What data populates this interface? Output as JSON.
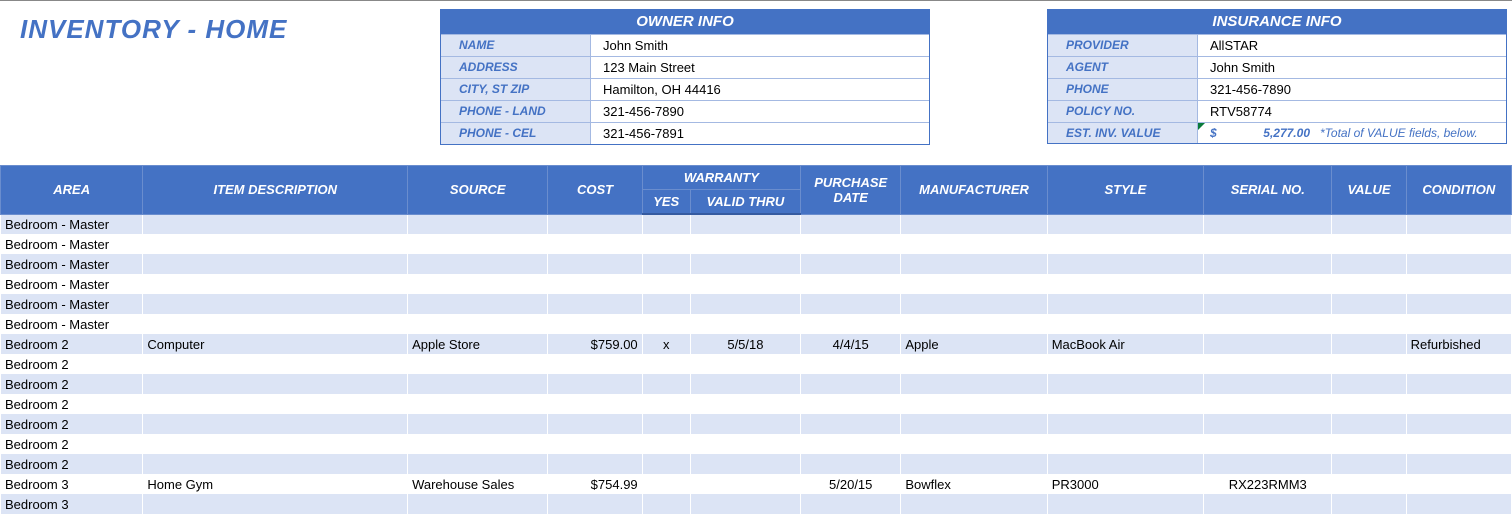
{
  "title": "INVENTORY - HOME",
  "owner_info": {
    "header": "OWNER INFO",
    "labels": {
      "name": "NAME",
      "address": "ADDRESS",
      "city": "CITY, ST  ZIP",
      "phone_land": "PHONE - LAND",
      "phone_cel": "PHONE - CEL"
    },
    "values": {
      "name": "John Smith",
      "address": "123 Main Street",
      "city": "Hamilton, OH  44416",
      "phone_land": "321-456-7890",
      "phone_cel": "321-456-7891"
    }
  },
  "insurance_info": {
    "header": "INSURANCE INFO",
    "labels": {
      "provider": "PROVIDER",
      "agent": "AGENT",
      "phone": "PHONE",
      "policy": "POLICY NO.",
      "est": "EST. INV. VALUE"
    },
    "values": {
      "provider": "AllSTAR",
      "agent": "John Smith",
      "phone": "321-456-7890",
      "policy": "RTV58774"
    },
    "est_currency": "$",
    "est_amount": "5,277.00",
    "est_note": "*Total of VALUE fields, below."
  },
  "columns": {
    "area": "AREA",
    "desc": "ITEM DESCRIPTION",
    "source": "SOURCE",
    "cost": "COST",
    "warranty": "WARRANTY",
    "yes": "YES",
    "valid_thru": "VALID THRU",
    "pdate": "PURCHASE DATE",
    "mfr": "MANUFACTURER",
    "style": "STYLE",
    "serial": "SERIAL NO.",
    "value": "VALUE",
    "cond": "CONDITION"
  },
  "rows": [
    {
      "area": "Bedroom - Master",
      "desc": "",
      "source": "",
      "cost": "",
      "yes": "",
      "thru": "",
      "pdate": "",
      "mfr": "",
      "style": "",
      "serial": "",
      "value": "",
      "cond": ""
    },
    {
      "area": "Bedroom - Master",
      "desc": "",
      "source": "",
      "cost": "",
      "yes": "",
      "thru": "",
      "pdate": "",
      "mfr": "",
      "style": "",
      "serial": "",
      "value": "",
      "cond": ""
    },
    {
      "area": "Bedroom - Master",
      "desc": "",
      "source": "",
      "cost": "",
      "yes": "",
      "thru": "",
      "pdate": "",
      "mfr": "",
      "style": "",
      "serial": "",
      "value": "",
      "cond": ""
    },
    {
      "area": "Bedroom - Master",
      "desc": "",
      "source": "",
      "cost": "",
      "yes": "",
      "thru": "",
      "pdate": "",
      "mfr": "",
      "style": "",
      "serial": "",
      "value": "",
      "cond": ""
    },
    {
      "area": "Bedroom - Master",
      "desc": "",
      "source": "",
      "cost": "",
      "yes": "",
      "thru": "",
      "pdate": "",
      "mfr": "",
      "style": "",
      "serial": "",
      "value": "",
      "cond": ""
    },
    {
      "area": "Bedroom - Master",
      "desc": "",
      "source": "",
      "cost": "",
      "yes": "",
      "thru": "",
      "pdate": "",
      "mfr": "",
      "style": "",
      "serial": "",
      "value": "",
      "cond": ""
    },
    {
      "area": "Bedroom 2",
      "desc": "Computer",
      "source": "Apple Store",
      "cost": "$759.00",
      "yes": "x",
      "thru": "5/5/18",
      "pdate": "4/4/15",
      "mfr": "Apple",
      "style": "MacBook Air",
      "serial": "",
      "value": "",
      "cond": "Refurbished"
    },
    {
      "area": "Bedroom 2",
      "desc": "",
      "source": "",
      "cost": "",
      "yes": "",
      "thru": "",
      "pdate": "",
      "mfr": "",
      "style": "",
      "serial": "",
      "value": "",
      "cond": ""
    },
    {
      "area": "Bedroom 2",
      "desc": "",
      "source": "",
      "cost": "",
      "yes": "",
      "thru": "",
      "pdate": "",
      "mfr": "",
      "style": "",
      "serial": "",
      "value": "",
      "cond": ""
    },
    {
      "area": "Bedroom 2",
      "desc": "",
      "source": "",
      "cost": "",
      "yes": "",
      "thru": "",
      "pdate": "",
      "mfr": "",
      "style": "",
      "serial": "",
      "value": "",
      "cond": ""
    },
    {
      "area": "Bedroom 2",
      "desc": "",
      "source": "",
      "cost": "",
      "yes": "",
      "thru": "",
      "pdate": "",
      "mfr": "",
      "style": "",
      "serial": "",
      "value": "",
      "cond": ""
    },
    {
      "area": "Bedroom 2",
      "desc": "",
      "source": "",
      "cost": "",
      "yes": "",
      "thru": "",
      "pdate": "",
      "mfr": "",
      "style": "",
      "serial": "",
      "value": "",
      "cond": ""
    },
    {
      "area": "Bedroom 2",
      "desc": "",
      "source": "",
      "cost": "",
      "yes": "",
      "thru": "",
      "pdate": "",
      "mfr": "",
      "style": "",
      "serial": "",
      "value": "",
      "cond": ""
    },
    {
      "area": "Bedroom 3",
      "desc": "Home Gym",
      "source": "Warehouse Sales",
      "cost": "$754.99",
      "yes": "",
      "thru": "",
      "pdate": "5/20/15",
      "mfr": "Bowflex",
      "style": "PR3000",
      "serial": "RX223RMM3",
      "value": "",
      "cond": ""
    },
    {
      "area": "Bedroom 3",
      "desc": "",
      "source": "",
      "cost": "",
      "yes": "",
      "thru": "",
      "pdate": "",
      "mfr": "",
      "style": "",
      "serial": "",
      "value": "",
      "cond": ""
    }
  ]
}
